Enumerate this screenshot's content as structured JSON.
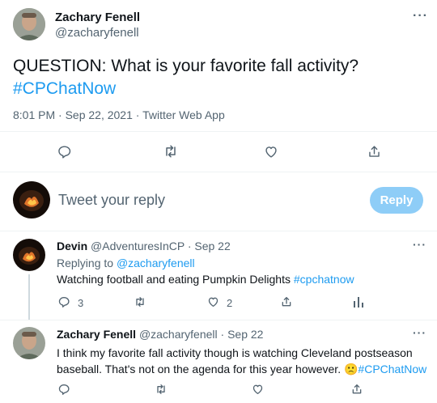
{
  "main_tweet": {
    "author_name": "Zachary Fenell",
    "author_handle": "@zacharyfenell",
    "text_line1": "QUESTION: What is your favorite fall activity?",
    "hashtag": "#CPChatNow",
    "meta": "8:01 PM · Sep 22, 2021 · Twitter Web App",
    "more_icon": "more-icon"
  },
  "reply_box": {
    "placeholder": "Tweet your reply",
    "button_label": "Reply",
    "button_color": "#8ecdf7"
  },
  "replies": [
    {
      "author_name": "Devin",
      "author_handle": "@AdventuresInCP",
      "date": "· Sep 22",
      "replying_prefix": "Replying to ",
      "replying_handle": "@zacharyfenell",
      "text": "Watching football and eating Pumpkin Delights ",
      "hashtag": "#cpchatnow",
      "reply_count": "3",
      "like_count": "2"
    },
    {
      "author_name": "Zachary Fenell",
      "author_handle": "@zacharyfenell",
      "date": "· Sep 22",
      "text_line1": "I think my favorite fall activity though is watching Cleveland postseason",
      "text_line2": "baseball. That's not on the agenda for this year however. ",
      "emoji": "🙁",
      "hashtag": "#CPChatNow"
    }
  ],
  "colors": {
    "accent": "#1d9bf0",
    "muted": "#536471",
    "divider": "#eff3f4"
  }
}
